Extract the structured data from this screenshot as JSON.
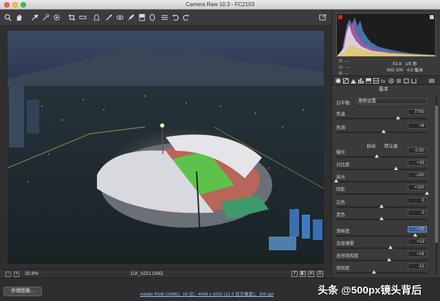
{
  "window": {
    "title": "Camera Raw 10.3  -  FC2103"
  },
  "toolbar": {
    "tools": [
      "zoom-icon",
      "hand-icon",
      "white-balance-icon",
      "color-sampler-icon",
      "target-adjust-icon",
      "crop-icon",
      "straighten-icon",
      "spot-removal-icon",
      "redeye-icon",
      "adjustment-brush-icon",
      "graduated-filter-icon",
      "radial-filter-icon",
      "preferences-icon",
      "rotate-left-icon",
      "rotate-right-icon",
      "fullscreen-icon"
    ]
  },
  "status": {
    "minus": "-",
    "plus": "+",
    "zoom": "20.9%",
    "filename": "DJI_0221.DNG",
    "view_y": "Y",
    "view_compare": "◧",
    "view_swap": "⇄",
    "view_settings": "☰"
  },
  "footer": {
    "save_label": "存储图像...",
    "workflow": "Adobe RGB (1998)；16 位；4048 x 3032 (12.3 百万像素)；300 ppi",
    "watermark": "头条 @500px镜头背后"
  },
  "info": {
    "r": "R:   ---",
    "g": "G:   ---",
    "b": "B:   ---",
    "aperture": "f/2.8",
    "shutter": "1/5 秒",
    "iso": "ISO 100",
    "focal": "4.5 毫米"
  },
  "panel": {
    "section_title": "基本",
    "wb_label": "白平衡:",
    "wb_value": "原照设置",
    "auto_label": "自动",
    "default_label": "默认值",
    "sliders": [
      {
        "label": "色温",
        "value": "7700",
        "pos": 0.68
      },
      {
        "label": "色调",
        "value": "+6",
        "pos": 0.52
      },
      {
        "label": "曝光",
        "value": "-0.50",
        "pos": 0.45
      },
      {
        "label": "对比度",
        "value": "+33",
        "pos": 0.66
      },
      {
        "label": "高光",
        "value": "-100",
        "pos": 0.0
      },
      {
        "label": "阴影",
        "value": "+100",
        "pos": 1.0
      },
      {
        "label": "白色",
        "value": "0",
        "pos": 0.5
      },
      {
        "label": "黑色",
        "value": "0",
        "pos": 0.5
      },
      {
        "label": "清晰度",
        "value": "+75",
        "pos": 0.87,
        "highlight": true
      },
      {
        "label": "去除薄雾",
        "value": "+19",
        "pos": 0.6
      },
      {
        "label": "自然饱和度",
        "value": "+16",
        "pos": 0.58
      },
      {
        "label": "饱和度",
        "value": "-15",
        "pos": 0.42
      }
    ]
  },
  "colors": {
    "accent": "#3b5f8f",
    "panel": "#3a3a3a",
    "background": "#2b2b2b"
  }
}
